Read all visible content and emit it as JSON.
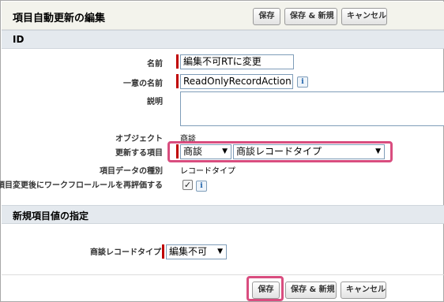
{
  "page": {
    "title": "項目自動更新の編集"
  },
  "buttons": {
    "save": "保存",
    "save_new": "保存 & 新規",
    "cancel": "キャンセル"
  },
  "section_id": {
    "title": "ID",
    "fields": {
      "name_label": "名前",
      "name_value": "編集不可RTに変更",
      "unique_name_label": "一意の名前",
      "unique_name_value": "ReadOnlyRecordAction",
      "description_label": "説明",
      "description_value": "",
      "object_label": "オブジェクト",
      "object_value": "商談",
      "field_to_update_label": "更新する項目",
      "field_to_update_object": "商談",
      "field_to_update_field": "商談レコードタイプ",
      "field_data_type_label": "項目データの種別",
      "field_data_type_value": "レコードタイプ",
      "reevaluate_label": "項目変更後にワークフロールールを再評価する",
      "reevaluate_checked": true
    }
  },
  "section_new_value": {
    "title": "新規項目値の指定",
    "record_type_label": "商談レコードタイプ",
    "record_type_value": "編集不可"
  },
  "icons": {
    "info": "i",
    "dropdown": "▼",
    "check": "✓"
  },
  "colors": {
    "highlight": "#d94d7f",
    "required": "#c00000",
    "section_bg": "#e4e9ee"
  }
}
